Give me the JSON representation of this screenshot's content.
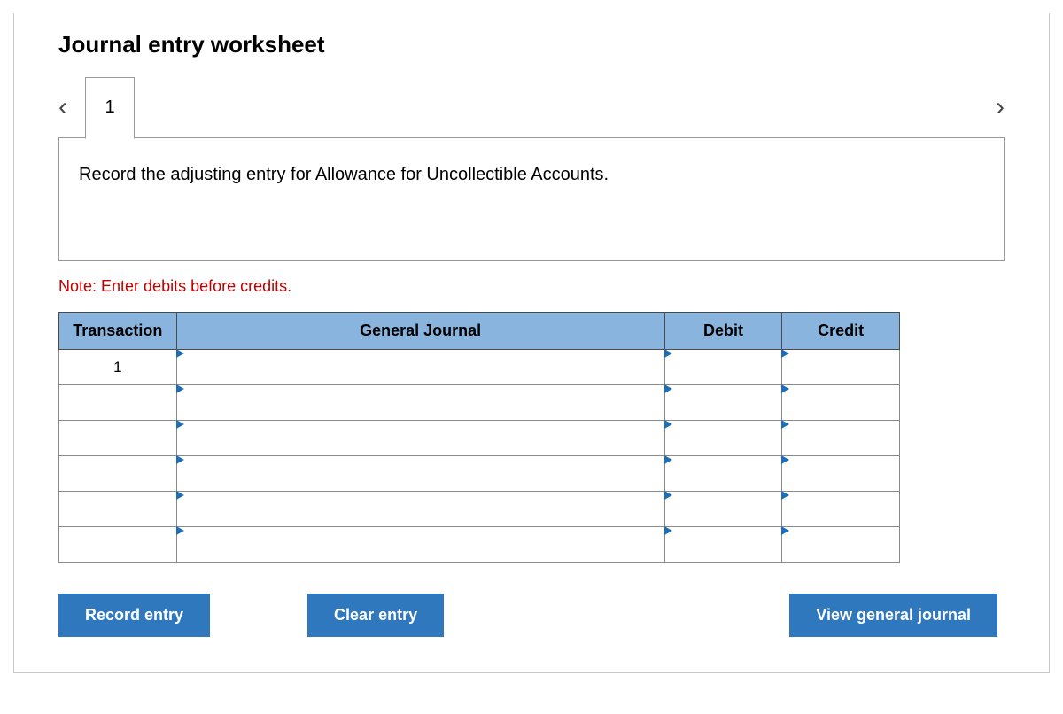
{
  "title": "Journal entry worksheet",
  "nav": {
    "prev_glyph": "‹",
    "next_glyph": "›",
    "tab_label": "1"
  },
  "instruction": "Record the adjusting entry for Allowance for Uncollectible Accounts.",
  "note": "Note: Enter debits before credits.",
  "table": {
    "headers": {
      "transaction": "Transaction",
      "general_journal": "General Journal",
      "debit": "Debit",
      "credit": "Credit"
    },
    "rows": [
      {
        "transaction": "1",
        "general_journal": "",
        "debit": "",
        "credit": ""
      },
      {
        "transaction": "",
        "general_journal": "",
        "debit": "",
        "credit": ""
      },
      {
        "transaction": "",
        "general_journal": "",
        "debit": "",
        "credit": ""
      },
      {
        "transaction": "",
        "general_journal": "",
        "debit": "",
        "credit": ""
      },
      {
        "transaction": "",
        "general_journal": "",
        "debit": "",
        "credit": ""
      },
      {
        "transaction": "",
        "general_journal": "",
        "debit": "",
        "credit": ""
      }
    ]
  },
  "buttons": {
    "record": "Record entry",
    "clear": "Clear entry",
    "view": "View general journal"
  }
}
